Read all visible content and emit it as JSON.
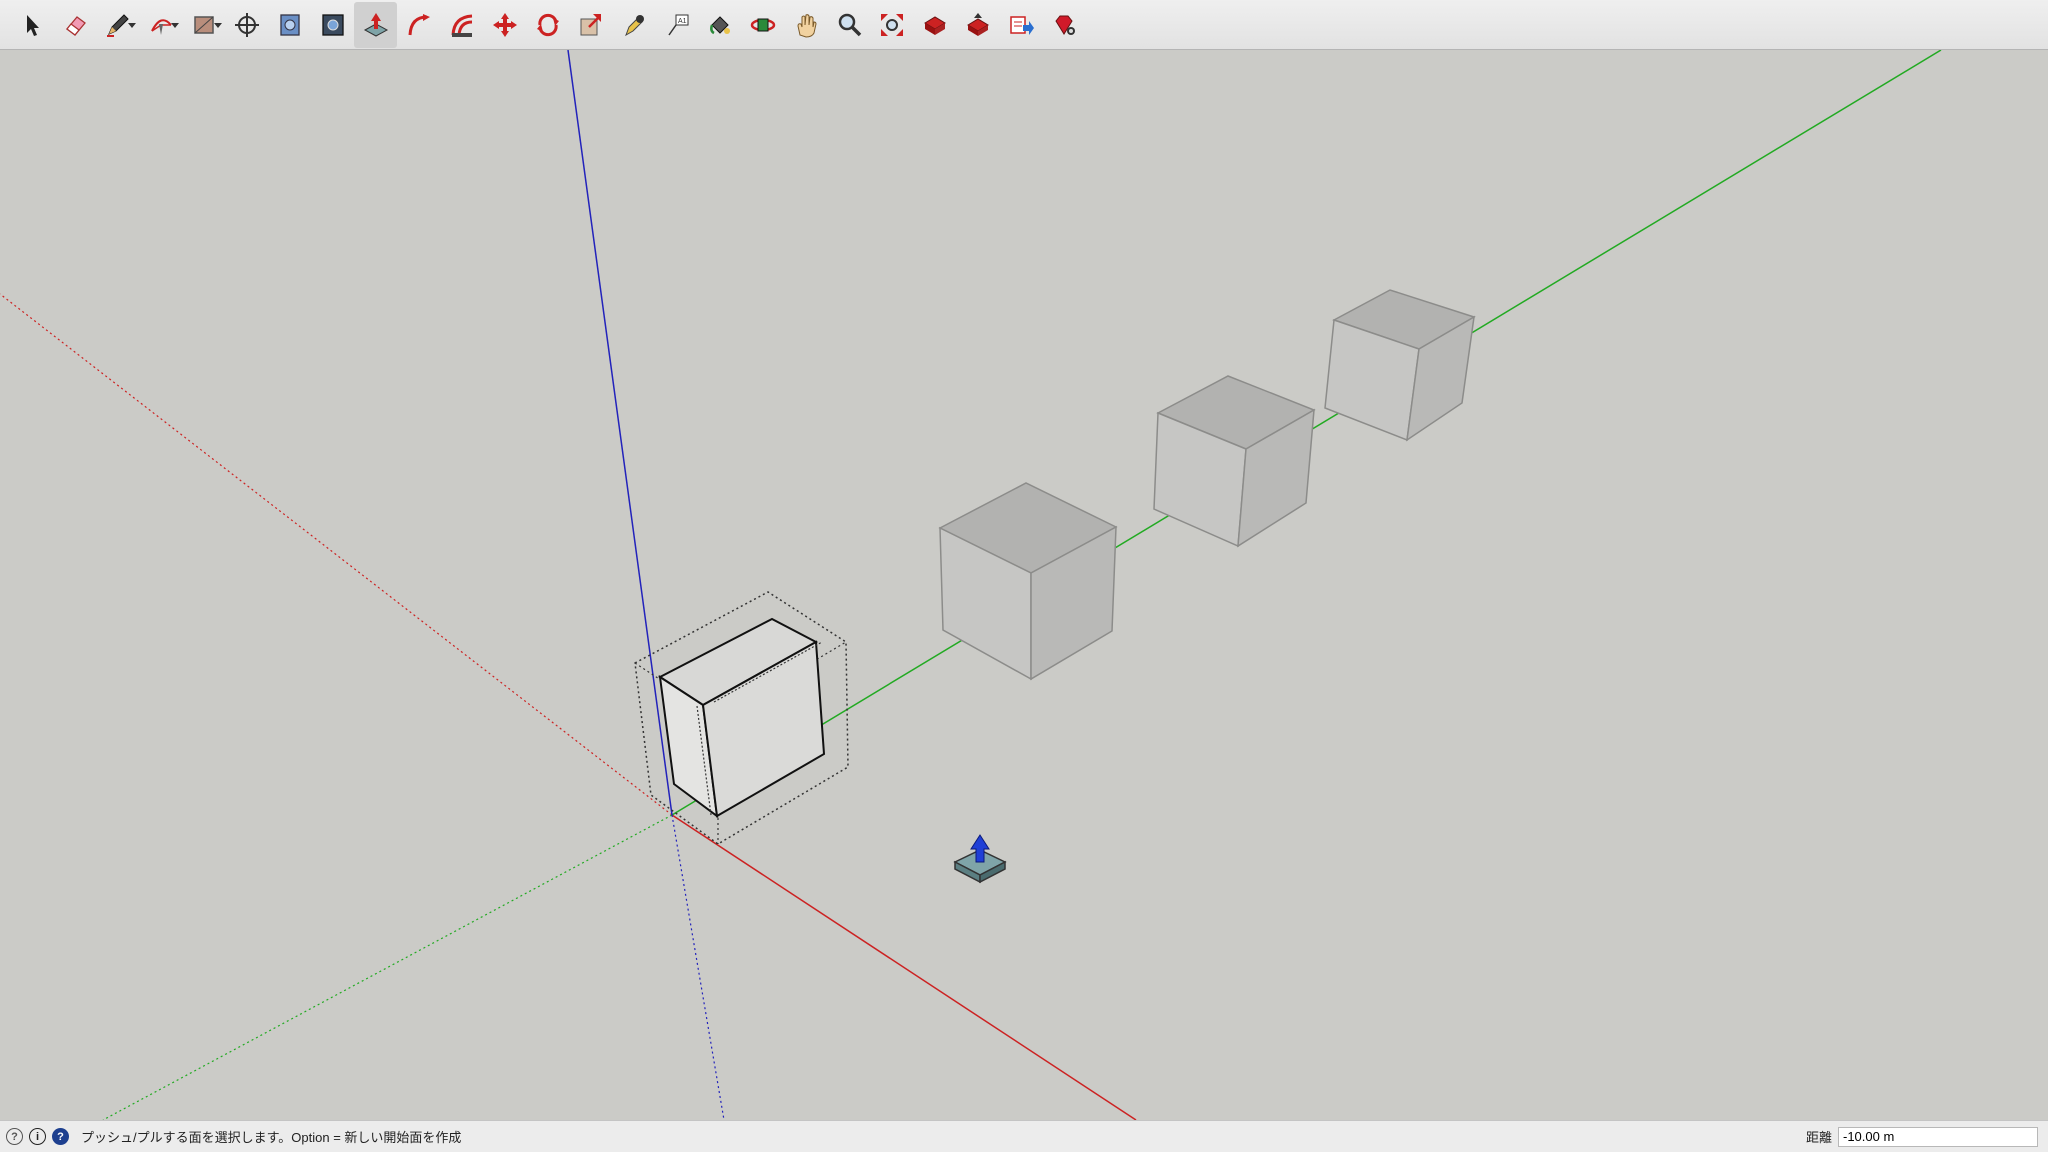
{
  "toolbar": {
    "tools": [
      {
        "name": "select-tool-button",
        "icon": "select-arrow-icon"
      },
      {
        "name": "eraser-tool-button",
        "icon": "eraser-icon"
      },
      {
        "name": "line-tool-button",
        "icon": "pencil-icon",
        "dropdown": true
      },
      {
        "name": "arc-tool-button",
        "icon": "arc-icon",
        "dropdown": true
      },
      {
        "name": "rectangle-tool-button",
        "icon": "rectangle-icon",
        "dropdown": true
      },
      {
        "name": "orbit-target-button",
        "icon": "target-icon"
      },
      {
        "name": "component-button",
        "icon": "component-icon"
      },
      {
        "name": "component-tool-button",
        "icon": "component-dark-icon"
      },
      {
        "name": "push-pull-tool-button",
        "icon": "push-pull-icon",
        "active": true
      },
      {
        "name": "follow-me-tool-button",
        "icon": "follow-me-icon"
      },
      {
        "name": "offset-tool-button",
        "icon": "offset-icon"
      },
      {
        "name": "move-tool-button",
        "icon": "move-icon"
      },
      {
        "name": "rotate-tool-button",
        "icon": "rotate-icon"
      },
      {
        "name": "scale-tool-button",
        "icon": "scale-icon"
      },
      {
        "name": "tape-measure-tool-button",
        "icon": "tape-measure-icon"
      },
      {
        "name": "text-tool-button",
        "icon": "text-label-icon"
      },
      {
        "name": "paint-bucket-tool-button",
        "icon": "paint-bucket-icon"
      },
      {
        "name": "orbit-tool-button",
        "icon": "orbit-icon"
      },
      {
        "name": "pan-tool-button",
        "icon": "hand-icon"
      },
      {
        "name": "zoom-tool-button",
        "icon": "magnifier-icon"
      },
      {
        "name": "zoom-extents-button",
        "icon": "zoom-extents-icon"
      },
      {
        "name": "3d-warehouse-button",
        "icon": "warehouse-icon"
      },
      {
        "name": "share-model-button",
        "icon": "share-model-icon"
      },
      {
        "name": "layout-send-button",
        "icon": "send-to-layout-icon"
      },
      {
        "name": "extension-warehouse-button",
        "icon": "ruby-gem-icon"
      }
    ]
  },
  "status": {
    "text": "プッシュ/プルする面を選択します。Option = 新しい開始面を作成",
    "icons": [
      "geolocation-icon",
      "credits-icon",
      "instructor-help-icon"
    ]
  },
  "measurements": {
    "label": "距離",
    "value": "-10.00 m"
  },
  "colors": {
    "background": "#cbcbc7",
    "axis_red": "#cc2222",
    "axis_green": "#22aa22",
    "axis_blue": "#2222bb",
    "toolbar": "#e8e8e8"
  }
}
